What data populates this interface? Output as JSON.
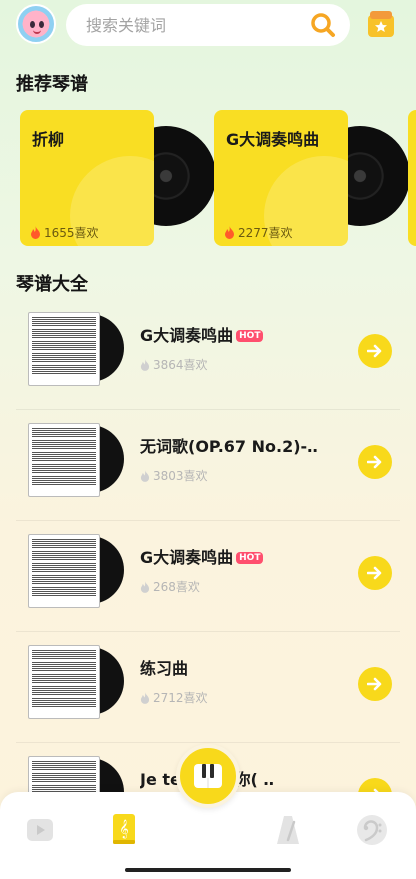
{
  "search": {
    "placeholder": "搜索关键词"
  },
  "sections": {
    "recommended_title": "推荐琴谱",
    "all_title": "琴谱大全"
  },
  "recommended": [
    {
      "title": "折柳",
      "likes": "1655喜欢"
    },
    {
      "title": "G大调奏鸣曲",
      "likes": "2277喜欢"
    }
  ],
  "scores": [
    {
      "title": "G大调奏鸣曲",
      "hot": "HOT",
      "likes": "3864喜欢"
    },
    {
      "title": "无词歌(OP.67  No.2)-‥",
      "hot": "",
      "likes": "3803喜欢"
    },
    {
      "title": "G大调奏鸣曲",
      "hot": "HOT",
      "likes": "268喜欢"
    },
    {
      "title": "练习曲",
      "hot": "",
      "likes": "2712喜欢"
    },
    {
      "title": "Je  te     我需要你( ‥",
      "hot": "",
      "likes": ""
    }
  ],
  "tabs": [
    {
      "icon": "video-tab-icon"
    },
    {
      "icon": "score-book-tab-icon"
    },
    {
      "icon": "metronome-tab-icon"
    },
    {
      "icon": "bass-clef-tab-icon"
    }
  ],
  "colors": {
    "accent": "#f8d91b",
    "hot": "#ff4f6e",
    "fire": "#ff5a2a"
  }
}
